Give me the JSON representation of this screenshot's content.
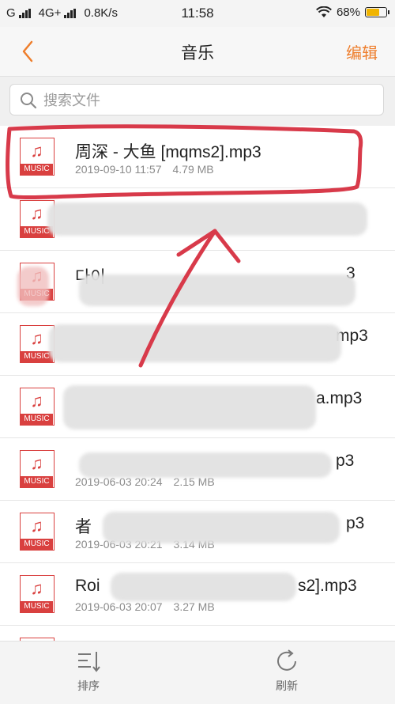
{
  "status_bar": {
    "carrier_left": "G",
    "carrier_right": "4G+",
    "speed": "0.8K/s",
    "time": "11:58",
    "battery_pct": "68%",
    "battery_level": 0.68,
    "battery_color": "#f0b400"
  },
  "header": {
    "title": "音乐",
    "edit_label": "编辑",
    "back_icon": "chevron-left-icon",
    "accent_color": "#ee7e2c"
  },
  "search": {
    "placeholder": "搜索文件"
  },
  "music_icon": {
    "note": "♫",
    "label": "MUSIC",
    "color": "#d9403f"
  },
  "files": [
    {
      "name": "周深 - 大鱼 [mqms2].mp3",
      "date": "2019-09-10 11:57",
      "size": "4.79 MB",
      "highlighted": true
    },
    {
      "name": "",
      "date": "",
      "size": ""
    },
    {
      "name": "다이",
      "date": "",
      "size": "",
      "name_suffix": "3"
    },
    {
      "name": "",
      "date": "",
      "size": "",
      "name_suffix": "mp3"
    },
    {
      "name": "",
      "date": "",
      "size": "",
      "name_suffix": "a.mp3"
    },
    {
      "name": "",
      "date": "2019-06-03 20:24",
      "size": "2.15 MB",
      "name_suffix": "p3"
    },
    {
      "name": "者",
      "date": "2019-06-03 20:21",
      "size": "3.14 MB",
      "name_suffix": "p3"
    },
    {
      "name": "Roi",
      "date": "2019-06-03 20:07",
      "size": "3.27 MB",
      "name_suffix": "s2].mp3"
    }
  ],
  "bottom_bar": {
    "sort_label": "排序",
    "refresh_label": "刷新"
  }
}
